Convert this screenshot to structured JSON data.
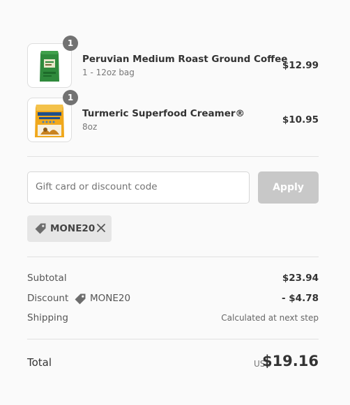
{
  "cart": {
    "items": [
      {
        "name": "Peruvian Medium Roast Ground Coffee",
        "variant": "1 - 12oz bag",
        "price": "$12.99",
        "quantity": "1"
      },
      {
        "name": "Turmeric Superfood Creamer®",
        "variant": "8oz",
        "price": "$10.95",
        "quantity": "1"
      }
    ]
  },
  "discount": {
    "placeholder": "Gift card or discount code",
    "apply_label": "Apply",
    "applied_code": "MONE20"
  },
  "summary": {
    "subtotal_label": "Subtotal",
    "subtotal_value": "$23.94",
    "discount_label": "Discount",
    "discount_code": "MONE20",
    "discount_value": "- $4.78",
    "shipping_label": "Shipping",
    "shipping_value": "Calculated at next step",
    "total_label": "Total",
    "currency": "USD",
    "total_value": "$19.16"
  },
  "colors": {
    "background": "#fafafa",
    "badge": "#727272",
    "apply_disabled": "#c8c8c8",
    "tag_background": "#e6e6e6"
  }
}
